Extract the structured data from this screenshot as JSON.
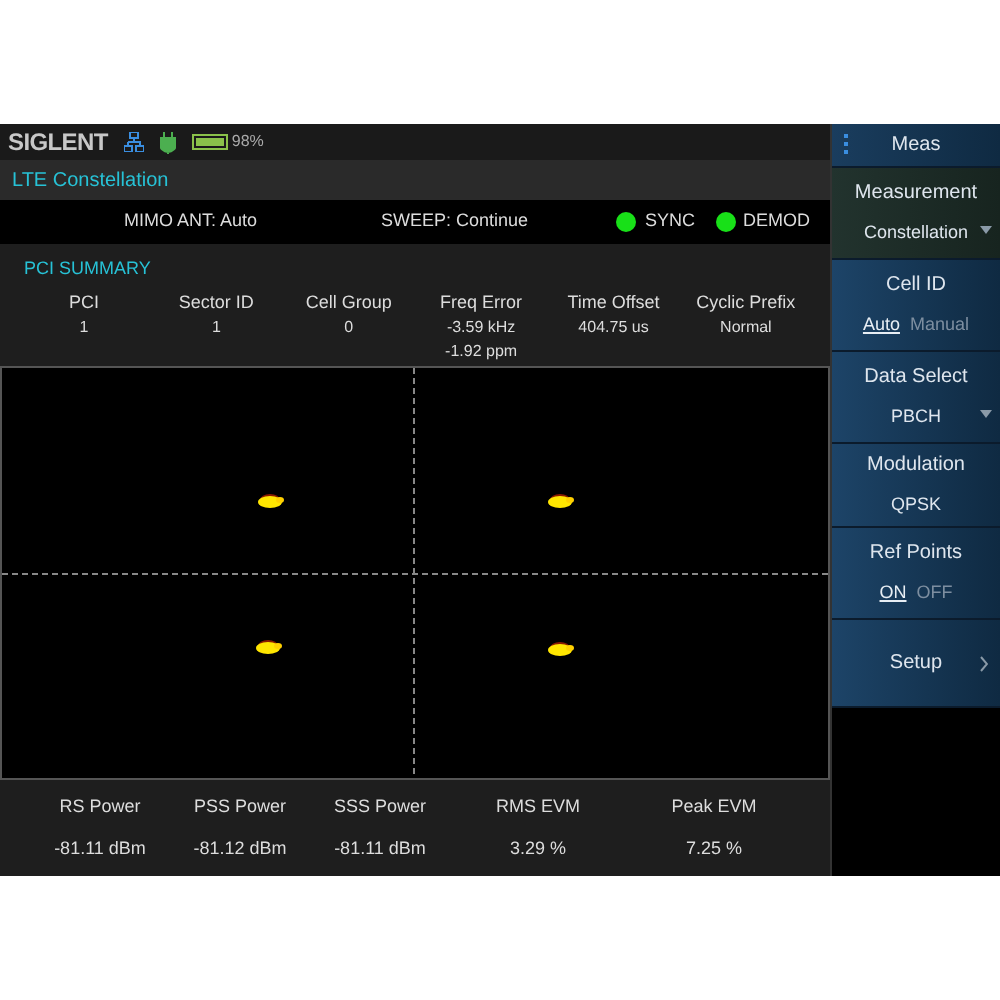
{
  "status_bar": {
    "brand": "SIGLENT",
    "battery": {
      "reading": "98%"
    }
  },
  "title": "LTE Constellation",
  "info_bar": {
    "fields": [
      "MIMO ANT: Auto",
      "SWEEP: Continue"
    ],
    "indicators": [
      {
        "label": "SYNC",
        "on": true
      },
      {
        "label": "DEMOD",
        "on": true
      }
    ]
  },
  "pci_summary": {
    "heading": "PCI SUMMARY",
    "columns": [
      {
        "label": "PCI",
        "values": [
          "1"
        ]
      },
      {
        "label": "Sector ID",
        "values": [
          "1"
        ]
      },
      {
        "label": "Cell Group",
        "values": [
          "0"
        ]
      },
      {
        "label": "Freq Error",
        "values": [
          "-3.59 kHz",
          "-1.92 ppm"
        ]
      },
      {
        "label": "Time Offset",
        "values": [
          "404.75 us"
        ]
      },
      {
        "label": "Cyclic Prefix",
        "values": [
          "Normal"
        ]
      }
    ]
  },
  "metrics": [
    {
      "label": "RS Power",
      "value": "-81.11 dBm"
    },
    {
      "label": "PSS Power",
      "value": "-81.12 dBm"
    },
    {
      "label": "SSS Power",
      "value": "-81.11 dBm"
    },
    {
      "label": "RMS EVM",
      "value": "3.29 %"
    },
    {
      "label": "Peak EVM",
      "value": "7.25 %"
    }
  ],
  "softkeys": [
    {
      "kind": "header",
      "label": "Meas"
    },
    {
      "kind": "dropdown",
      "label": "Measurement",
      "value": "Constellation"
    },
    {
      "kind": "toggle",
      "label": "Cell ID",
      "options": [
        {
          "label": "Auto",
          "selected": true
        },
        {
          "label": "Manual",
          "selected": false
        }
      ]
    },
    {
      "kind": "dropdown",
      "label": "Data Select",
      "value": "PBCH"
    },
    {
      "kind": "value",
      "label": "Modulation",
      "value": "QPSK"
    },
    {
      "kind": "toggle",
      "label": "Ref Points",
      "options": [
        {
          "label": "ON",
          "selected": true
        },
        {
          "label": "OFF",
          "selected": false
        }
      ]
    },
    {
      "kind": "submenu",
      "label": "Setup"
    }
  ]
}
